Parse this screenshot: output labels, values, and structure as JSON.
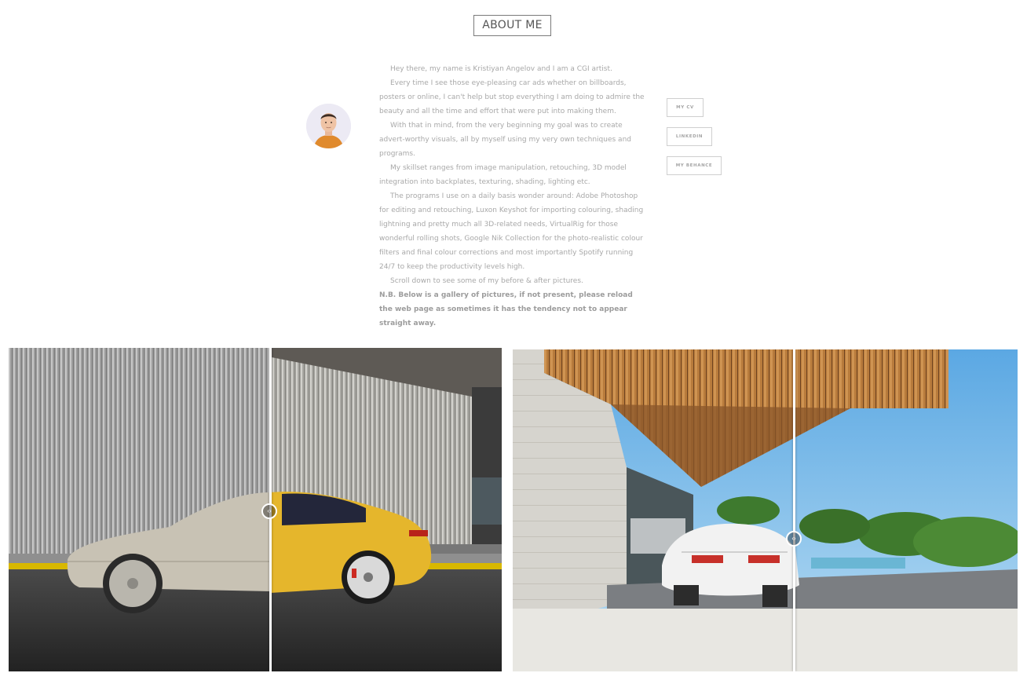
{
  "header": {
    "title": "ABOUT ME"
  },
  "bio": {
    "paragraphs": [
      "Hey there, my name is Kristiyan Angelov and I am a CGI artist.",
      "Every time I see those eye-pleasing car ads whether on billboards, posters or online, I can't help but stop everything I am doing to admire the beauty and all the time and effort that were put into making them.",
      "With that in mind, from the very beginning my goal  was to create advert-worthy visuals, all by myself using my very own techniques and programs.",
      "My skillset ranges from image manipulation, retouching, 3D model integration into backplates, texturing, shading, lighting etc.",
      "The programs I use on a daily basis wonder around: Adobe Photoshop for editing and retouching, Luxon Keyshot for importing colouring, shading lightning and pretty much all 3D-related needs, VirtualRig for those wonderful rolling shots, Google Nik Collection for the photo-realistic colour filters and final colour corrections and most importantly Spotify running 24/7 to keep the productivity levels high.",
      "Scroll down to see some of my before & after pictures."
    ],
    "note": "N.B. Below is a gallery of pictures, if not present, please reload the web page as sometimes it has the tendency not to appear straight away."
  },
  "links": {
    "cv": "MY CV",
    "linkedin": "LINKEDIN",
    "behance": "MY BEHANCE"
  },
  "gallery": {
    "slider1_handle": "‹›",
    "slider2_handle": "‹›"
  },
  "colors": {
    "car_yellow": "#e5b62c",
    "sky_blue": "#7ec2ec",
    "wood": "#b87b3c"
  }
}
